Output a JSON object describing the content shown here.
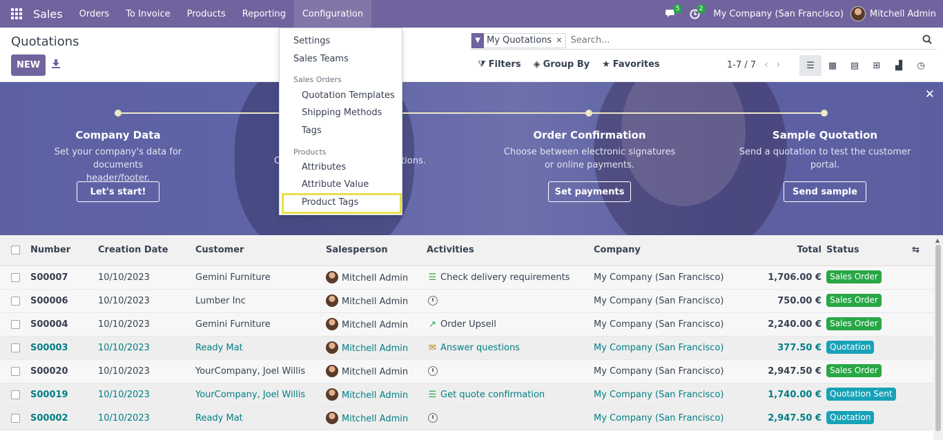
{
  "nav": {
    "brand": "Sales",
    "items": [
      "Orders",
      "To Invoice",
      "Products",
      "Reporting",
      "Configuration"
    ],
    "messages_count": "5",
    "activities_count": "2",
    "company": "My Company (San Francisco)",
    "user": "Mitchell Admin"
  },
  "control": {
    "title": "Quotations",
    "new_label": "NEW",
    "facet_label": "My Quotations",
    "search_placeholder": "Search...",
    "filters": "Filters",
    "group_by": "Group By",
    "favorites": "Favorites",
    "pager": "1-7 / 7"
  },
  "dropdown": {
    "settings": "Settings",
    "sales_teams": "Sales Teams",
    "header_orders": "Sales Orders",
    "quotation_templates": "Quotation Templates",
    "shipping_methods": "Shipping Methods",
    "tags": "Tags",
    "header_products": "Products",
    "attributes": "Attributes",
    "attribute_value": "Attribute Value",
    "product_tags": "Product Tags"
  },
  "banner": {
    "steps": [
      {
        "title": "Company Data",
        "desc1": "Set your company's data for documents",
        "desc2": "header/footer.",
        "button": "Let's start!"
      },
      {
        "title": "",
        "desc1": "C",
        "desc2": "",
        "button": ""
      },
      {
        "partial": "tations."
      },
      {
        "title": "Order Confirmation",
        "desc1": "Choose between electronic signatures",
        "desc2": "or online payments.",
        "button": "Set payments"
      },
      {
        "title": "Sample Quotation",
        "desc1": "Send a quotation to test the customer",
        "desc2": "portal.",
        "button": "Send sample"
      }
    ]
  },
  "table": {
    "headers": {
      "number": "Number",
      "date": "Creation Date",
      "customer": "Customer",
      "salesperson": "Salesperson",
      "activities": "Activities",
      "company": "Company",
      "total": "Total",
      "status": "Status"
    },
    "rows": [
      {
        "number": "S00007",
        "date": "10/10/2023",
        "customer": "Gemini Furniture",
        "salesperson": "Mitchell Admin",
        "activity": "Check delivery requirements",
        "company": "My Company (San Francisco)",
        "total": "1,706.00 €",
        "status": "Sales Order"
      },
      {
        "number": "S00006",
        "date": "10/10/2023",
        "customer": "Lumber Inc",
        "salesperson": "Mitchell Admin",
        "activity": "",
        "company": "My Company (San Francisco)",
        "total": "750.00 €",
        "status": "Sales Order"
      },
      {
        "number": "S00004",
        "date": "10/10/2023",
        "customer": "Gemini Furniture",
        "salesperson": "Mitchell Admin",
        "activity": "Order Upsell",
        "company": "My Company (San Francisco)",
        "total": "2,240.00 €",
        "status": "Sales Order"
      },
      {
        "number": "S00003",
        "date": "10/10/2023",
        "customer": "Ready Mat",
        "salesperson": "Mitchell Admin",
        "activity": "Answer questions",
        "company": "My Company (San Francisco)",
        "total": "377.50 €",
        "status": "Quotation"
      },
      {
        "number": "S00020",
        "date": "10/10/2023",
        "customer": "YourCompany, Joel Willis",
        "salesperson": "Mitchell Admin",
        "activity": "",
        "company": "My Company (San Francisco)",
        "total": "2,947.50 €",
        "status": "Sales Order"
      },
      {
        "number": "S00019",
        "date": "10/10/2023",
        "customer": "YourCompany, Joel Willis",
        "salesperson": "Mitchell Admin",
        "activity": "Get quote confirmation",
        "company": "My Company (San Francisco)",
        "total": "1,740.00 €",
        "status": "Quotation Sent"
      },
      {
        "number": "S00002",
        "date": "10/10/2023",
        "customer": "Ready Mat",
        "salesperson": "Mitchell Admin",
        "activity": "",
        "company": "My Company (San Francisco)",
        "total": "2,947.50 €",
        "status": "Quotation"
      }
    ]
  }
}
